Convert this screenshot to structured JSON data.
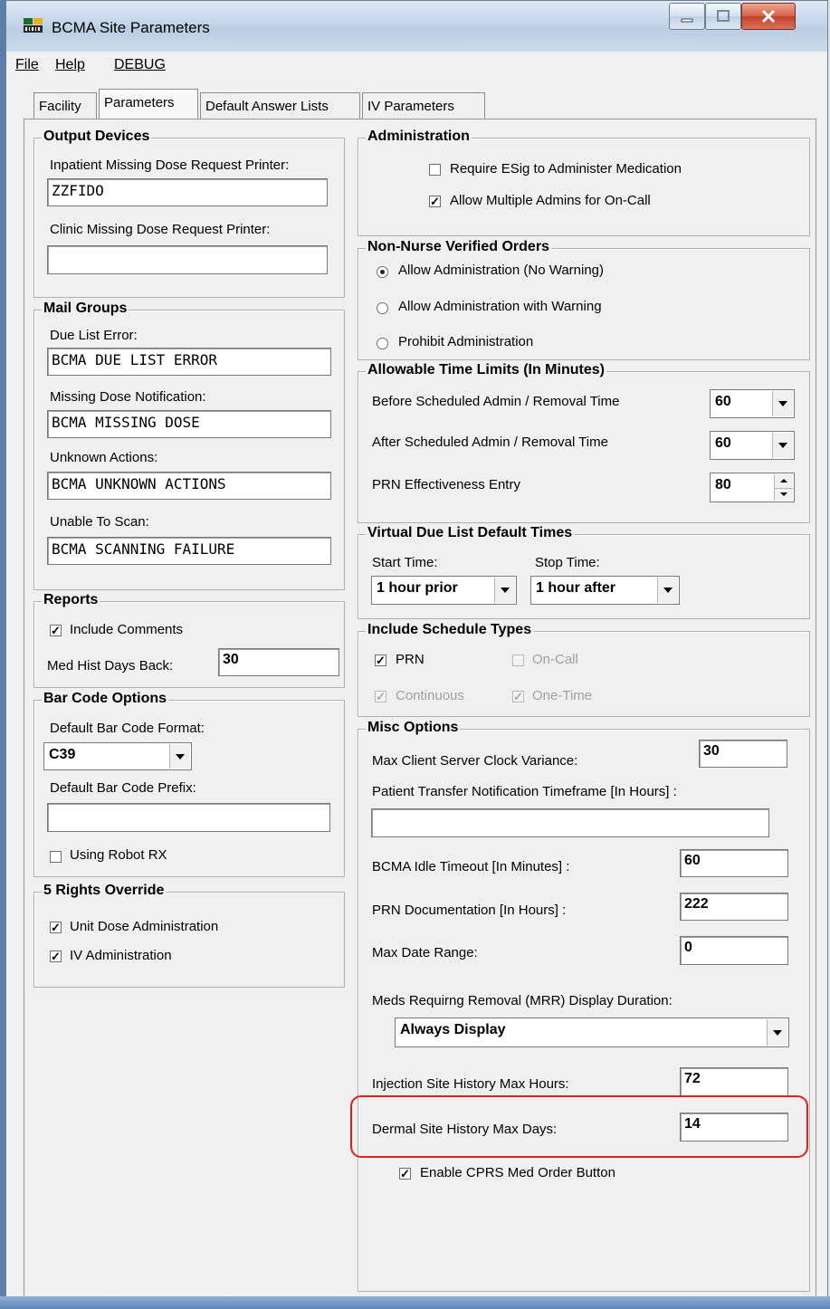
{
  "window": {
    "title": "BCMA Site Parameters",
    "icon": "bcma-app-icon"
  },
  "menu": {
    "items": [
      "File",
      "Help",
      "DEBUG"
    ]
  },
  "tabs": [
    "Facility",
    "Parameters",
    "Default Answer Lists",
    "IV Parameters"
  ],
  "active_tab": "Parameters",
  "output_devices": {
    "title": "Output Devices",
    "inpatient_label": "Inpatient Missing Dose Request Printer:",
    "inpatient_value": "ZZFIDO",
    "clinic_label": "Clinic Missing Dose Request Printer:",
    "clinic_value": ""
  },
  "mail_groups": {
    "title": "Mail Groups",
    "due_list_label": "Due List Error:",
    "due_list_value": "BCMA DUE LIST ERROR",
    "missing_dose_label": "Missing Dose Notification:",
    "missing_dose_value": "BCMA MISSING DOSE",
    "unknown_label": "Unknown Actions:",
    "unknown_value": "BCMA UNKNOWN ACTIONS",
    "unable_label": "Unable To Scan:",
    "unable_value": "BCMA SCANNING FAILURE"
  },
  "reports": {
    "title": "Reports",
    "include_comments_label": "Include Comments",
    "include_comments_checked": true,
    "med_hist_label": "Med Hist Days Back:",
    "med_hist_value": "30"
  },
  "bar_code": {
    "title": "Bar Code Options",
    "format_label": "Default Bar Code Format:",
    "format_value": "C39",
    "prefix_label": "Default Bar Code Prefix:",
    "prefix_value": "",
    "robot_label": "Using Robot RX",
    "robot_checked": false
  },
  "five_rights": {
    "title": "5 Rights Override",
    "unit_dose_label": "Unit Dose Administration",
    "unit_dose_checked": true,
    "iv_label": "IV Administration",
    "iv_checked": true
  },
  "administration": {
    "title": "Administration",
    "esig_label": "Require ESig to Administer Medication",
    "esig_checked": false,
    "multi_label": "Allow Multiple Admins for On-Call",
    "multi_checked": true
  },
  "non_nurse": {
    "title": "Non-Nurse Verified Orders",
    "options": [
      "Allow Administration (No Warning)",
      "Allow Administration with Warning",
      "Prohibit Administration"
    ],
    "selected": 0
  },
  "time_limits": {
    "title": "Allowable Time Limits (In Minutes)",
    "before_label": "Before Scheduled Admin / Removal Time",
    "before_value": "60",
    "after_label": "After Scheduled Admin / Removal Time",
    "after_value": "60",
    "prn_label": "PRN Effectiveness Entry",
    "prn_value": "80"
  },
  "virtual_due": {
    "title": "Virtual Due List Default Times",
    "start_label": "Start Time:",
    "start_value": "1 hour prior",
    "stop_label": "Stop Time:",
    "stop_value": "1 hour after"
  },
  "schedule_types": {
    "title": "Include Schedule Types",
    "prn_label": "PRN",
    "oncall_label": "On-Call",
    "continuous_label": "Continuous",
    "onetime_label": "One-Time"
  },
  "misc": {
    "title": "Misc Options",
    "clock_label": "Max Client Server Clock Variance:",
    "clock_value": "30",
    "transfer_label": "Patient Transfer Notification Timeframe [In Hours] :",
    "transfer_value": "",
    "idle_label": "BCMA Idle Timeout [In Minutes] :",
    "idle_value": "60",
    "prn_doc_label": "PRN Documentation [In Hours] :",
    "prn_doc_value": "222",
    "date_range_label": "Max Date Range:",
    "date_range_value": "0",
    "mrr_label": "Meds Requirng Removal (MRR) Display Duration:",
    "mrr_value": "Always Display",
    "injection_label": "Injection Site History Max Hours:",
    "injection_value": "72",
    "dermal_label": "Dermal Site History Max Days:",
    "dermal_value": "14",
    "cprs_label": "Enable CPRS Med Order Button",
    "cprs_checked": true
  },
  "colors": {
    "highlight": "#e02020",
    "titlebar": "#c4d6ea"
  }
}
